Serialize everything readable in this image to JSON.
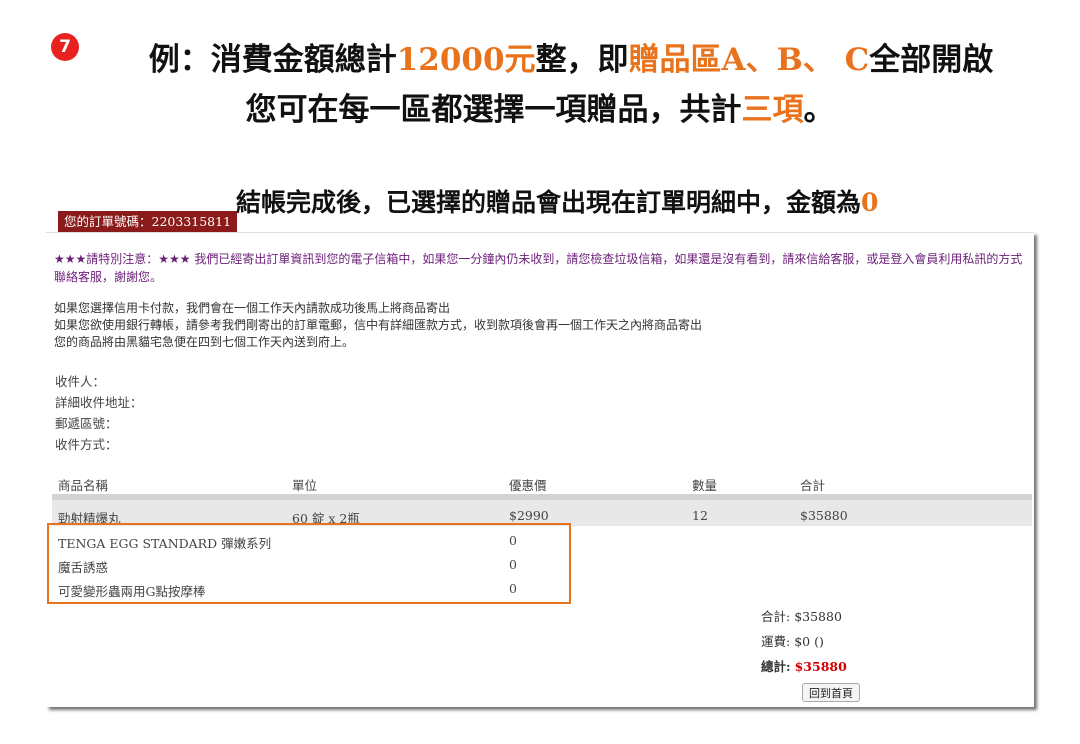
{
  "step": "7",
  "headline1": {
    "a": "例：消費金額總計",
    "b": "12000元",
    "c": "整，即",
    "d": "贈品區A、B、 C",
    "e": "全部開啟"
  },
  "headline2": {
    "a": "您可在每一區都選擇一項贈品，共計",
    "b": "三項",
    "c": "。"
  },
  "headline3": {
    "a": "結帳完成後，已選擇的贈品會出現在訂單明細中，金額為",
    "b": "0"
  },
  "order": {
    "label": "您的訂單號碼：2203315811"
  },
  "notice": "★★★請特別注意：★★★ 我們已經寄出訂單資訊到您的電子信箱中，如果您一分鐘內仍未收到，請您檢查垃圾信箱，如果還是沒有看到，請來信給客服，或是登入會員利用私訊的方式聯絡客服，謝謝您。",
  "info": [
    "如果您選擇信用卡付款，我們會在一個工作天內請款成功後馬上將商品寄出",
    "如果您欲使用銀行轉帳，請參考我們剛寄出的訂單電郵，信中有詳細匯款方式，收到款項後會再一個工作天之內將商品寄出",
    "您的商品將由黑貓宅急便在四到七個工作天內送到府上。"
  ],
  "recipient": {
    "name": "收件人：",
    "address": "詳細收件地址：",
    "zip": "郵遞區號：",
    "method": "收件方式："
  },
  "table": {
    "headers": {
      "name": "商品名稱",
      "unit": "單位",
      "price": "優惠價",
      "qty": "數量",
      "total": "合計"
    },
    "product": {
      "name": "勁射精爆丸",
      "unit": "60 錠 x 2瓶",
      "price": "$2990",
      "qty": "12",
      "total": "$35880"
    },
    "gifts": [
      {
        "name": "TENGA EGG STANDARD 彈嫩系列",
        "price": "0"
      },
      {
        "name": "魔舌誘惑",
        "price": "0"
      },
      {
        "name": "可愛變形蟲兩用G點按摩棒",
        "price": "0"
      }
    ]
  },
  "totals": {
    "subtotal_label": "合計:",
    "subtotal": "$35880",
    "shipping_label": "運費:",
    "shipping": "$0 ()",
    "grand_label": "總計:",
    "grand": "$35880"
  },
  "home_button": "回到首頁",
  "colors": {
    "accent": "#e8731c",
    "badge": "#e8231f",
    "order_tag": "#8b1a1a",
    "notice": "#6b1e77",
    "total": "#d40000"
  }
}
